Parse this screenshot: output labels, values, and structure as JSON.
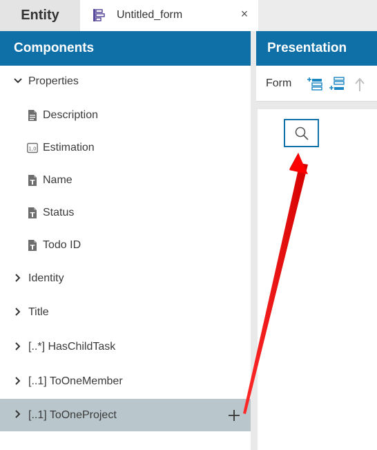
{
  "tabs": {
    "entity_label": "Entity",
    "form_label": "Untitled_form",
    "close_glyph": "×"
  },
  "components": {
    "header": "Components",
    "properties": {
      "label": "Properties",
      "children": [
        "Description",
        "Estimation",
        "Name",
        "Status",
        "Todo ID"
      ]
    },
    "groups": [
      "Identity",
      "Title",
      "[..*] HasChildTask",
      "[..1] ToOneMember",
      "[..1] ToOneProject"
    ],
    "selected": "[..1] ToOneProject"
  },
  "presentation": {
    "header": "Presentation",
    "toolbar_label": "Form"
  },
  "colors": {
    "accent": "#0f6fa7",
    "selected_row": "#b9c7cc",
    "arrow": "#ff0000"
  }
}
